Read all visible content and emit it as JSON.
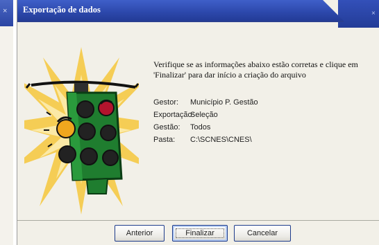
{
  "window": {
    "title": "Exportação de dados",
    "close_glyph": "×"
  },
  "background_window": {
    "close_glyph": "×"
  },
  "intro_text": "Verifique se as informações abaixo estão corretas e clique em 'Finalizar' para dar início a criação do arquivo",
  "summary": [
    {
      "label": "Gestor:",
      "value": "Município P. Gestão"
    },
    {
      "label": "Exportação:",
      "value": "Seleção"
    },
    {
      "label": "Gestão:",
      "value": "Todos"
    },
    {
      "label": "Pasta:",
      "value": "C:\\SCNES\\CNES\\"
    }
  ],
  "buttons": {
    "back": "Anterior",
    "finish": "Finalizar",
    "cancel": "Cancelar"
  },
  "icons": {
    "illustration": "traffic-light-icon",
    "close": "close-icon"
  },
  "colors": {
    "titlebar": "#2c48ab",
    "dialog_bg": "#f2f0e8",
    "button_border": "#1c3a8a"
  }
}
